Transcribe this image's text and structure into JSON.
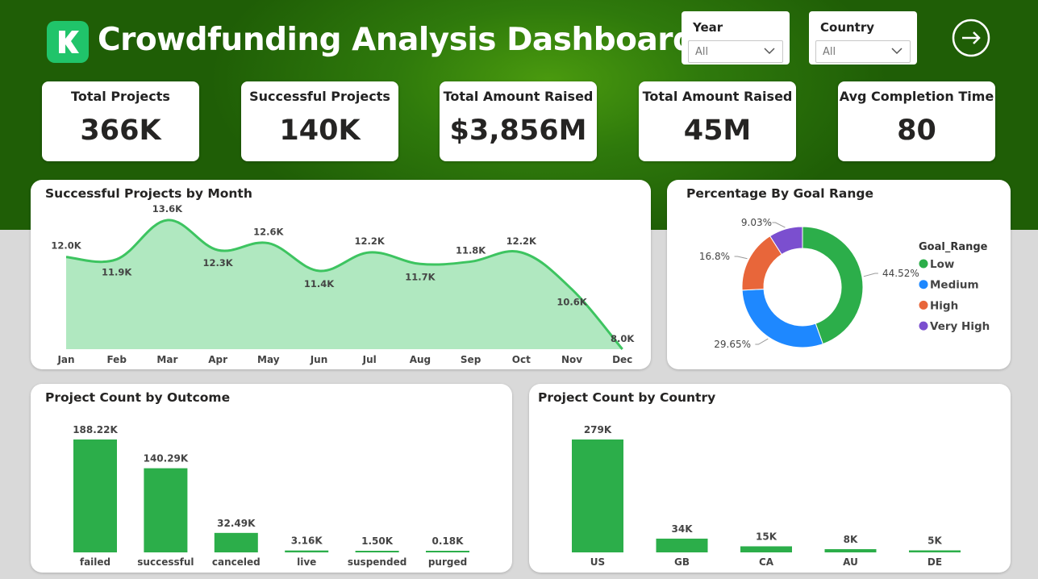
{
  "header": {
    "title": "Crowdfunding Analysis Dashboard",
    "logo_icon": "kickstarter-k-icon",
    "nav_icon": "arrow-right-circle-icon"
  },
  "slicers": {
    "year": {
      "label": "Year",
      "value": "All"
    },
    "country": {
      "label": "Country",
      "value": "All"
    }
  },
  "kpis": [
    {
      "label": "Total Projects",
      "value": "366K"
    },
    {
      "label": "Successful Projects",
      "value": "140K"
    },
    {
      "label": "Total Amount Raised",
      "value": "$3,856M"
    },
    {
      "label": "Total Amount Raised",
      "value": "45M"
    },
    {
      "label": "Avg Completion Time",
      "value": "80"
    }
  ],
  "colors": {
    "header_green": "#2f7a0c",
    "chart_green": "#2cae4a",
    "area_fill": "#b0e8c0",
    "line_green": "#3dc460",
    "blue": "#1e88ff",
    "orange": "#e8663a",
    "purple": "#7b4fcf"
  },
  "chart_data": [
    {
      "type": "area",
      "title": "Successful Projects by Month",
      "categories": [
        "Jan",
        "Feb",
        "Mar",
        "Apr",
        "May",
        "Jun",
        "Jul",
        "Aug",
        "Sep",
        "Oct",
        "Nov",
        "Dec"
      ],
      "values": [
        12.0,
        11.9,
        13.6,
        12.3,
        12.6,
        11.4,
        12.2,
        11.7,
        11.8,
        12.2,
        10.6,
        8.0
      ],
      "labels": [
        "12.0K",
        "11.9K",
        "13.6K",
        "12.3K",
        "12.6K",
        "11.4K",
        "12.2K",
        "11.7K",
        "11.8K",
        "12.2K",
        "10.6K",
        "8.0K"
      ],
      "ylim": [
        8.0,
        13.6
      ]
    },
    {
      "type": "pie",
      "title": "Percentage By Goal Range",
      "legend_title": "Goal_Range",
      "categories": [
        "Low",
        "Medium",
        "High",
        "Very High"
      ],
      "values": [
        44.52,
        29.65,
        16.8,
        9.03
      ],
      "labels": [
        "44.52%",
        "29.65%",
        "16.8%",
        "9.03%"
      ],
      "colors": [
        "#2cae4a",
        "#1e88ff",
        "#e8663a",
        "#7b4fcf"
      ]
    },
    {
      "type": "bar",
      "title": "Project Count by Outcome",
      "categories": [
        "failed",
        "successful",
        "canceled",
        "live",
        "suspended",
        "purged"
      ],
      "values": [
        188.22,
        140.29,
        32.49,
        3.16,
        1.5,
        0.18
      ],
      "labels": [
        "188.22K",
        "140.29K",
        "32.49K",
        "3.16K",
        "1.50K",
        "0.18K"
      ],
      "ylim": [
        0,
        188.22
      ]
    },
    {
      "type": "bar",
      "title": "Project Count by Country",
      "categories": [
        "US",
        "GB",
        "CA",
        "AU",
        "DE"
      ],
      "values": [
        279,
        34,
        15,
        8,
        5
      ],
      "labels": [
        "279K",
        "34K",
        "15K",
        "8K",
        "5K"
      ],
      "ylim": [
        0,
        279
      ]
    }
  ]
}
